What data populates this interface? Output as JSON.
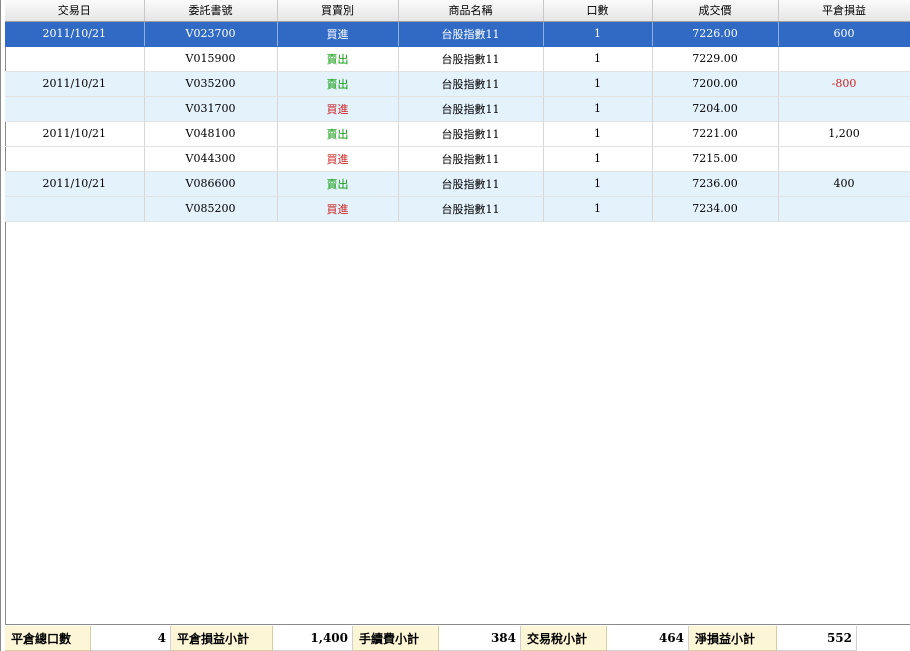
{
  "grid": {
    "headers": [
      "交易日",
      "委託書號",
      "買賣別",
      "商品名稱",
      "口數",
      "成交價",
      "平倉損益"
    ],
    "rows": [
      {
        "date": "2011/10/21",
        "order": "V023700",
        "side": "買進",
        "product": "台股指數11",
        "qty": "1",
        "price": "7226.00",
        "pnl": "600"
      },
      {
        "date": "",
        "order": "V015900",
        "side": "賣出",
        "product": "台股指數11",
        "qty": "1",
        "price": "7229.00",
        "pnl": ""
      },
      {
        "date": "2011/10/21",
        "order": "V035200",
        "side": "賣出",
        "product": "台股指數11",
        "qty": "1",
        "price": "7200.00",
        "pnl": "-800"
      },
      {
        "date": "",
        "order": "V031700",
        "side": "買進",
        "product": "台股指數11",
        "qty": "1",
        "price": "7204.00",
        "pnl": ""
      },
      {
        "date": "2011/10/21",
        "order": "V048100",
        "side": "賣出",
        "product": "台股指數11",
        "qty": "1",
        "price": "7221.00",
        "pnl": "1,200"
      },
      {
        "date": "",
        "order": "V044300",
        "side": "買進",
        "product": "台股指數11",
        "qty": "1",
        "price": "7215.00",
        "pnl": ""
      },
      {
        "date": "2011/10/21",
        "order": "V086600",
        "side": "賣出",
        "product": "台股指數11",
        "qty": "1",
        "price": "7236.00",
        "pnl": "400"
      },
      {
        "date": "",
        "order": "V085200",
        "side": "買進",
        "product": "台股指數11",
        "qty": "1",
        "price": "7234.00",
        "pnl": ""
      }
    ]
  },
  "summary": {
    "close_qty_label": "平倉總口數",
    "close_qty_value": "4",
    "close_pnl_label": "平倉損益小計",
    "close_pnl_value": "1,400",
    "fee_label": "手續費小計",
    "fee_value": "384",
    "tax_label": "交易稅小計",
    "tax_value": "464",
    "net_label": "淨損益小計",
    "net_value": "552"
  },
  "colors": {
    "selected_row": "#316ac5",
    "alt_row": "#e4f2fb",
    "buy": "#cc2222",
    "sell": "#0a9a0a",
    "summary_label_bg": "#fcf6d6"
  }
}
